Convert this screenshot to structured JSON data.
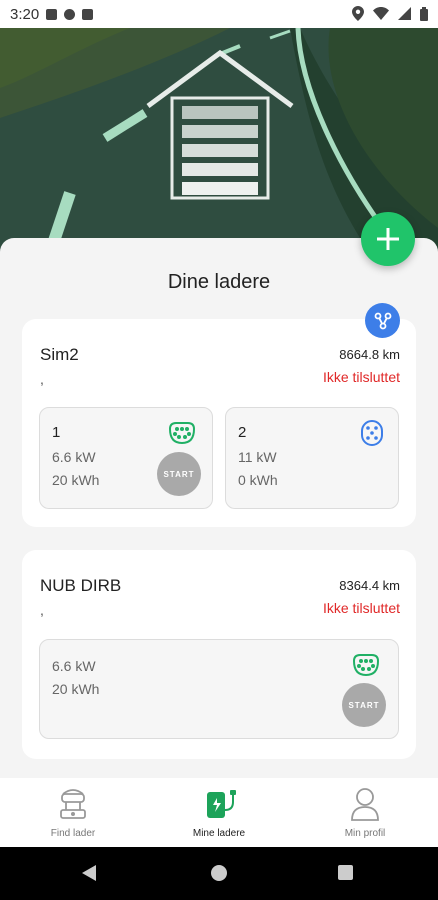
{
  "status_bar": {
    "time": "3:20"
  },
  "page": {
    "title": "Dine ladere"
  },
  "chargers": [
    {
      "name": "Sim2",
      "subtitle": ",",
      "distance": "8664.8 km",
      "status": "Ikke tilsluttet",
      "connectors": [
        {
          "number": "1",
          "power": "6.6 kW",
          "energy": "20 kWh",
          "plug_icon": "type2-plug-icon",
          "plug_color": "#20b065",
          "start_label": "START"
        },
        {
          "number": "2",
          "power": "11 kW",
          "energy": "0 kWh",
          "plug_icon": "ccs-plug-icon",
          "plug_color": "#3d7ee8"
        }
      ]
    },
    {
      "name": "NUB DIRB",
      "subtitle": ",",
      "distance": "8364.4 km",
      "status": "Ikke tilsluttet",
      "connectors": [
        {
          "power": "6.6 kW",
          "energy": "20 kWh",
          "plug_icon": "type2-plug-icon",
          "plug_color": "#20b065",
          "start_label": "START"
        }
      ]
    }
  ],
  "bottom_nav": [
    {
      "label": "Find lader",
      "icon": "find-charger-icon"
    },
    {
      "label": "Mine ladere",
      "icon": "my-chargers-icon",
      "active": true
    },
    {
      "label": "Min profil",
      "icon": "profile-icon"
    }
  ],
  "colors": {
    "accent": "#20c46a",
    "status_error": "#e02828",
    "share": "#3d7ee8"
  }
}
